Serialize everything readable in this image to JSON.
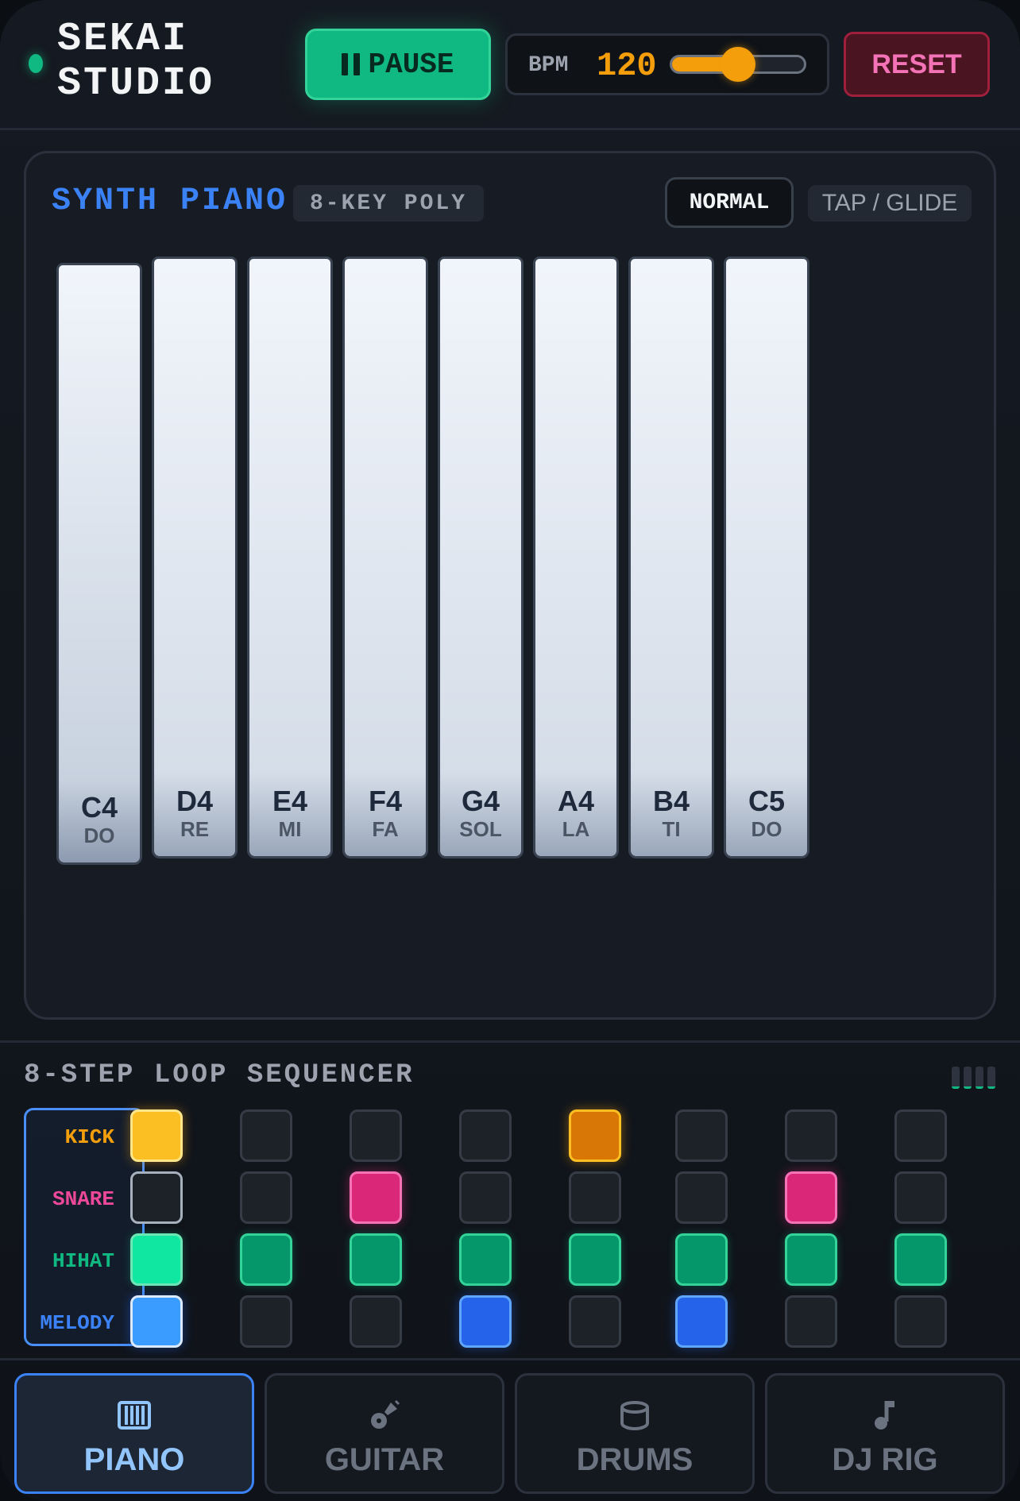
{
  "header": {
    "brand_line1": "SEKAI",
    "brand_line2": "STUDIO",
    "pause_label": "PAUSE",
    "bpm_label": "BPM",
    "bpm_value": "120",
    "bpm_slider_fraction": 0.5,
    "reset_label": "RESET"
  },
  "piano": {
    "title": "SYNTH PIANO",
    "badge": "8-KEY POLY",
    "mode_normal": "NORMAL",
    "mode_glide": "TAP / GLIDE",
    "keys": [
      {
        "note": "C4",
        "solfege": "DO",
        "pressed": true
      },
      {
        "note": "D4",
        "solfege": "RE",
        "pressed": false
      },
      {
        "note": "E4",
        "solfege": "MI",
        "pressed": false
      },
      {
        "note": "F4",
        "solfege": "FA",
        "pressed": false
      },
      {
        "note": "G4",
        "solfege": "SOL",
        "pressed": false
      },
      {
        "note": "A4",
        "solfege": "LA",
        "pressed": false
      },
      {
        "note": "B4",
        "solfege": "TI",
        "pressed": false
      },
      {
        "note": "C5",
        "solfege": "DO",
        "pressed": false
      }
    ]
  },
  "sequencer": {
    "title": "8-STEP LOOP SEQUENCER",
    "current_step": 0,
    "tracks": [
      {
        "name": "KICK",
        "color": "#f59e0b",
        "kind": "kick",
        "steps": [
          1,
          0,
          0,
          0,
          1,
          0,
          0,
          0
        ]
      },
      {
        "name": "SNARE",
        "color": "#ec4899",
        "kind": "snare",
        "steps": [
          0,
          0,
          1,
          0,
          0,
          0,
          1,
          0
        ]
      },
      {
        "name": "HIHAT",
        "color": "#10b981",
        "kind": "hihat",
        "steps": [
          1,
          1,
          1,
          1,
          1,
          1,
          1,
          1
        ]
      },
      {
        "name": "MELODY",
        "color": "#3b82f6",
        "kind": "melody",
        "steps": [
          1,
          0,
          0,
          1,
          0,
          1,
          0,
          0
        ]
      }
    ]
  },
  "nav": {
    "tabs": [
      {
        "label": "PIANO",
        "icon": "piano-icon",
        "active": true
      },
      {
        "label": "GUITAR",
        "icon": "guitar-icon",
        "active": false
      },
      {
        "label": "DRUMS",
        "icon": "drum-icon",
        "active": false
      },
      {
        "label": "DJ RIG",
        "icon": "music-note-icon",
        "active": false
      }
    ]
  }
}
